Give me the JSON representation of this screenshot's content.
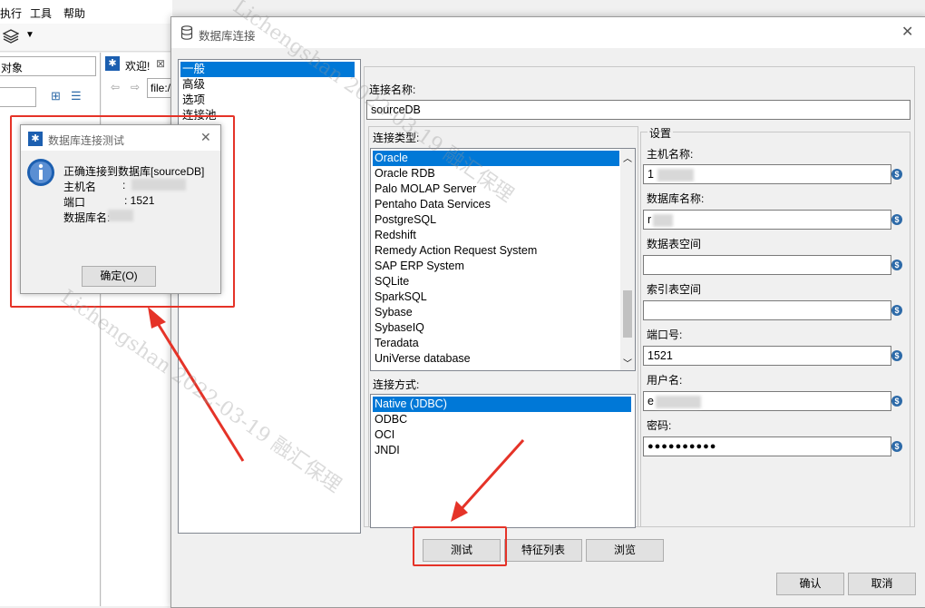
{
  "background_app": {
    "menu": [
      "执行",
      "工具",
      "帮助"
    ],
    "left_tab": "对象",
    "welcome_tab": "欢迎!",
    "address": "file:/"
  },
  "dialog": {
    "title": "数据库连接",
    "categories": [
      "一般",
      "高级",
      "选项",
      "连接池"
    ],
    "connection_name_label": "连接名称:",
    "connection_name_value": "sourceDB",
    "connection_type_label": "连接类型:",
    "connection_types": [
      "Oracle",
      "Oracle RDB",
      "Palo MOLAP Server",
      "Pentaho Data Services",
      "PostgreSQL",
      "Redshift",
      "Remedy Action Request System",
      "SAP ERP System",
      "SQLite",
      "SparkSQL",
      "Sybase",
      "SybaseIQ",
      "Teradata",
      "UniVerse database"
    ],
    "access_label": "连接方式:",
    "access_methods": [
      "Native (JDBC)",
      "ODBC",
      "OCI",
      "JNDI"
    ],
    "settings": {
      "group_label": "设置",
      "host_label": "主机名称:",
      "host_value": "1",
      "db_label": "数据库名称:",
      "db_value": "r",
      "tablespace_label": "数据表空间",
      "tablespace_value": "",
      "index_tablespace_label": "索引表空间",
      "index_tablespace_value": "",
      "port_label": "端口号:",
      "port_value": "1521",
      "user_label": "用户名:",
      "user_value": "e",
      "password_label": "密码:",
      "password_value": "●●●●●●●●●●"
    },
    "buttons": {
      "test": "测试",
      "features": "特征列表",
      "browse": "浏览",
      "ok": "确认",
      "cancel": "取消"
    }
  },
  "popup": {
    "title": "数据库连接测试",
    "message_line1": "正确连接到数据库[sourceDB]",
    "host_label": "主机名",
    "host_sep": ":",
    "port_label": "端口",
    "port_value": ": 1521",
    "db_label": "数据库名:",
    "ok_button": "确定(O)"
  },
  "watermark": {
    "line1": "Lichengshan 2022-03-19 融汇保理",
    "line2": "Lichengshan 2022-03-19 融汇保理"
  },
  "colors": {
    "selection": "#0078d7",
    "annotation_red": "#e53328",
    "info_icon": "#1c5fb0"
  }
}
